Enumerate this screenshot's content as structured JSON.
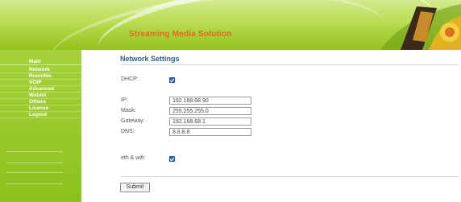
{
  "header": {
    "title": "Streaming Media Solution"
  },
  "sidebar": {
    "items": [
      {
        "label": "Main"
      },
      {
        "label": "Network"
      },
      {
        "label": "RoomNo."
      },
      {
        "label": "VOIP"
      },
      {
        "label": "Advanced"
      },
      {
        "label": "Webkit"
      },
      {
        "label": "Others"
      },
      {
        "label": "License"
      },
      {
        "label": "Logout"
      }
    ]
  },
  "main": {
    "title": "Network Settings",
    "dhcp": {
      "label": "DHCP:",
      "checked": true
    },
    "ip": {
      "label": "IP:",
      "value": "192.168.68.90"
    },
    "mask": {
      "label": "Mask:",
      "value": "255.255.255.0"
    },
    "gateway": {
      "label": "Gateway:",
      "value": "192.168.68.1"
    },
    "dns": {
      "label": "DNS:",
      "value": "8.8.8.8"
    },
    "eth_wifi": {
      "label": "eth & wifi:",
      "checked": true
    },
    "submit_label": "Submit"
  },
  "colors": {
    "banner_green": "#b9dc52",
    "sidebar_green": "#8cc21e",
    "title_blue": "#2d5e8c",
    "brand_orange": "#e3681b",
    "checkbox_blue": "#2f6fd6"
  }
}
